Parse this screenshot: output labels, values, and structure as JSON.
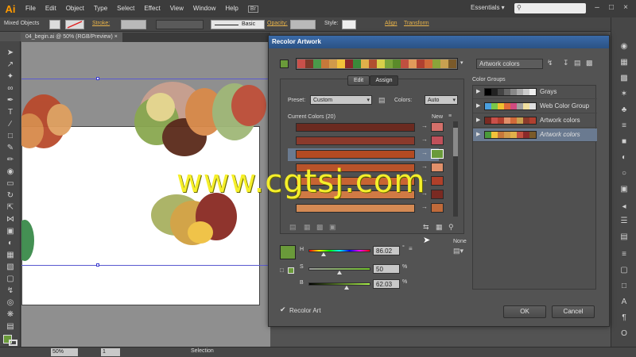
{
  "app": {
    "logo": "Ai",
    "workspace": "Essentials ▾",
    "bridge_badge": "Br"
  },
  "menu": [
    "File",
    "Edit",
    "Object",
    "Type",
    "Select",
    "Effect",
    "View",
    "Window",
    "Help"
  ],
  "control_bar": {
    "selection_label": "Mixed Objects",
    "stroke_label": "Stroke:",
    "brush_label": "Basic",
    "opacity_label": "Opacity:",
    "style_label": "Style:",
    "align_label": "Align",
    "transform_label": "Transform"
  },
  "document_tab": {
    "label": "04_begin.ai @ 50% (RGB/Preview)",
    "close": "×"
  },
  "status_bar": {
    "zoom": "50%",
    "page": "1",
    "mode": "Selection"
  },
  "dialog": {
    "title": "Recolor Artwork",
    "harmony_name": "Artwork colors",
    "harmony_strip": [
      "#c9504a",
      "#7c3a2a",
      "#4a9a4a",
      "#c7783a",
      "#d19a4a",
      "#f2c23a",
      "#8a2a2a",
      "#3a8a3a",
      "#e0b04a",
      "#b05030",
      "#d8d04a",
      "#7aa43a",
      "#5a8a2a",
      "#c05040",
      "#e09a5a",
      "#b04030",
      "#d06a3a",
      "#8aa43a",
      "#c8a050",
      "#7a5a2a"
    ],
    "tabs": {
      "edit": "Edit",
      "assign": "Assign"
    },
    "preset_label": "Preset:",
    "preset_value": "Custom",
    "colors_label": "Colors:",
    "colors_value": "Auto",
    "current_colors_label": "Current Colors (20)",
    "new_label": "New",
    "color_rows": [
      {
        "current": "#6b2a20",
        "new": "#d4706a"
      },
      {
        "current": "#8a3a2c",
        "new": "#c0505a"
      },
      {
        "current": "#b34a22",
        "new": "#6a9a3a",
        "selected": true
      },
      {
        "current": "#b9532a",
        "new": "#e0906a"
      },
      {
        "current": "#c86432",
        "new": "#b0402a"
      },
      {
        "current": "#d07a44",
        "new": "#7a2a22"
      },
      {
        "current": "#d48a54",
        "new": "#c06a3a"
      }
    ],
    "hsb": {
      "h_label": "H",
      "h_value": "86.02",
      "h_unit": "°",
      "h_level": 0.239,
      "s_label": "S",
      "s_value": "50",
      "s_unit": "%",
      "s_level": 0.5,
      "b_label": "B",
      "b_value": "62.03",
      "b_unit": "%",
      "b_level": 0.62
    },
    "active_color": "#6a9a3a",
    "none_label": "None",
    "recolor_art_label": "Recolor Art",
    "recolor_art_checked": true,
    "color_groups_label": "Color Groups",
    "color_groups": [
      {
        "name": "Grays",
        "colors": [
          "#000000",
          "#222",
          "#444",
          "#666",
          "#888",
          "#aaa",
          "#ccc",
          "#eee"
        ]
      },
      {
        "name": "Web Color Group",
        "colors": [
          "#4aa0e0",
          "#7ac84a",
          "#f0c030",
          "#e06a3a",
          "#d04a80",
          "#a0a0a0",
          "#f0e0a0",
          "#e0e0e0"
        ]
      },
      {
        "name": "Artwork colors",
        "colors": [
          "#7a2a22",
          "#c9504a",
          "#b04030",
          "#e0906a",
          "#d06a3a",
          "#c8a050",
          "#8a3a2a",
          "#b04030"
        ]
      },
      {
        "name": "Artwork colors",
        "colors": [
          "#4a9a3a",
          "#f2c23a",
          "#c7783a",
          "#d19a4a",
          "#e0b04a",
          "#c05040",
          "#8a2a2a",
          "#7a5a2a"
        ],
        "selected": true,
        "italic": true
      }
    ],
    "ok": "OK",
    "cancel": "Cancel"
  },
  "watermark": "www.cgtsj.com"
}
